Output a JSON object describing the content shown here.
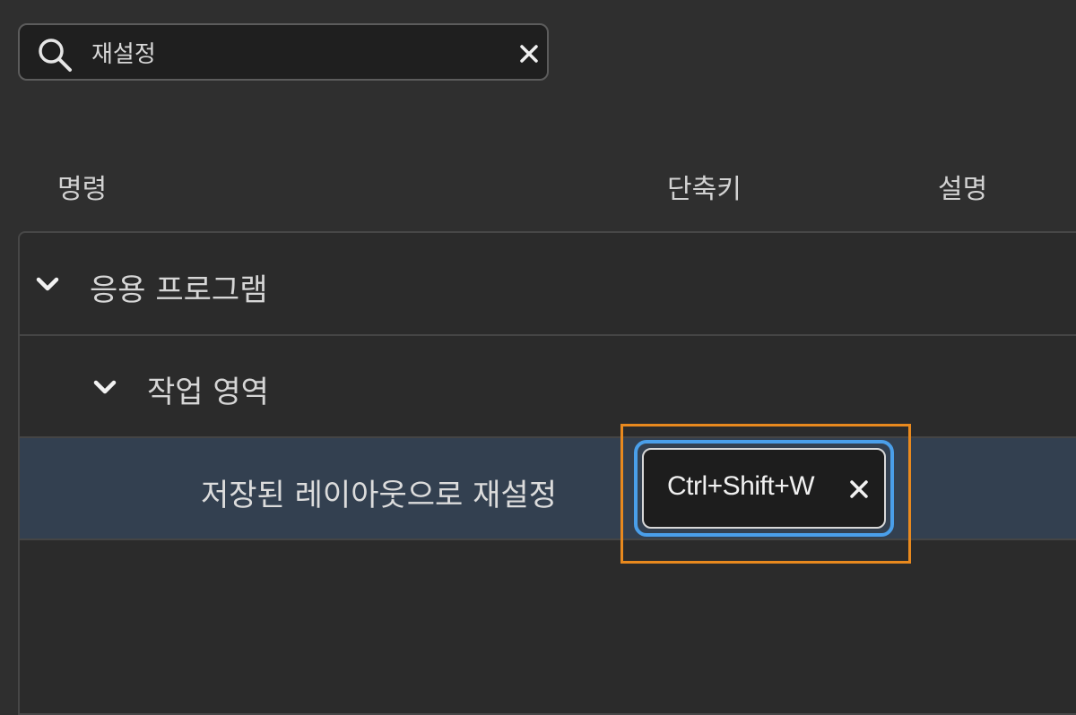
{
  "search": {
    "value": "재설정",
    "icon": "search-icon",
    "clear_icon": "close-icon"
  },
  "columns": {
    "command": "명령",
    "shortcut": "단축키",
    "description": "설명"
  },
  "tree": {
    "app_group": {
      "label": "응용 프로그램",
      "icon": "chevron-down-icon",
      "expanded": true
    },
    "workspace_group": {
      "label": "작업 영역",
      "icon": "chevron-down-icon",
      "expanded": true
    },
    "command_row": {
      "label": "저장된 레이아웃으로 재설정",
      "shortcut": "Ctrl+Shift+W",
      "remove_icon": "close-icon",
      "selected": true
    }
  },
  "colors": {
    "background": "#2f2f2f",
    "selected_row": "#334050",
    "highlight_outline": "#e8891e",
    "focus_ring": "#4a9fea"
  }
}
